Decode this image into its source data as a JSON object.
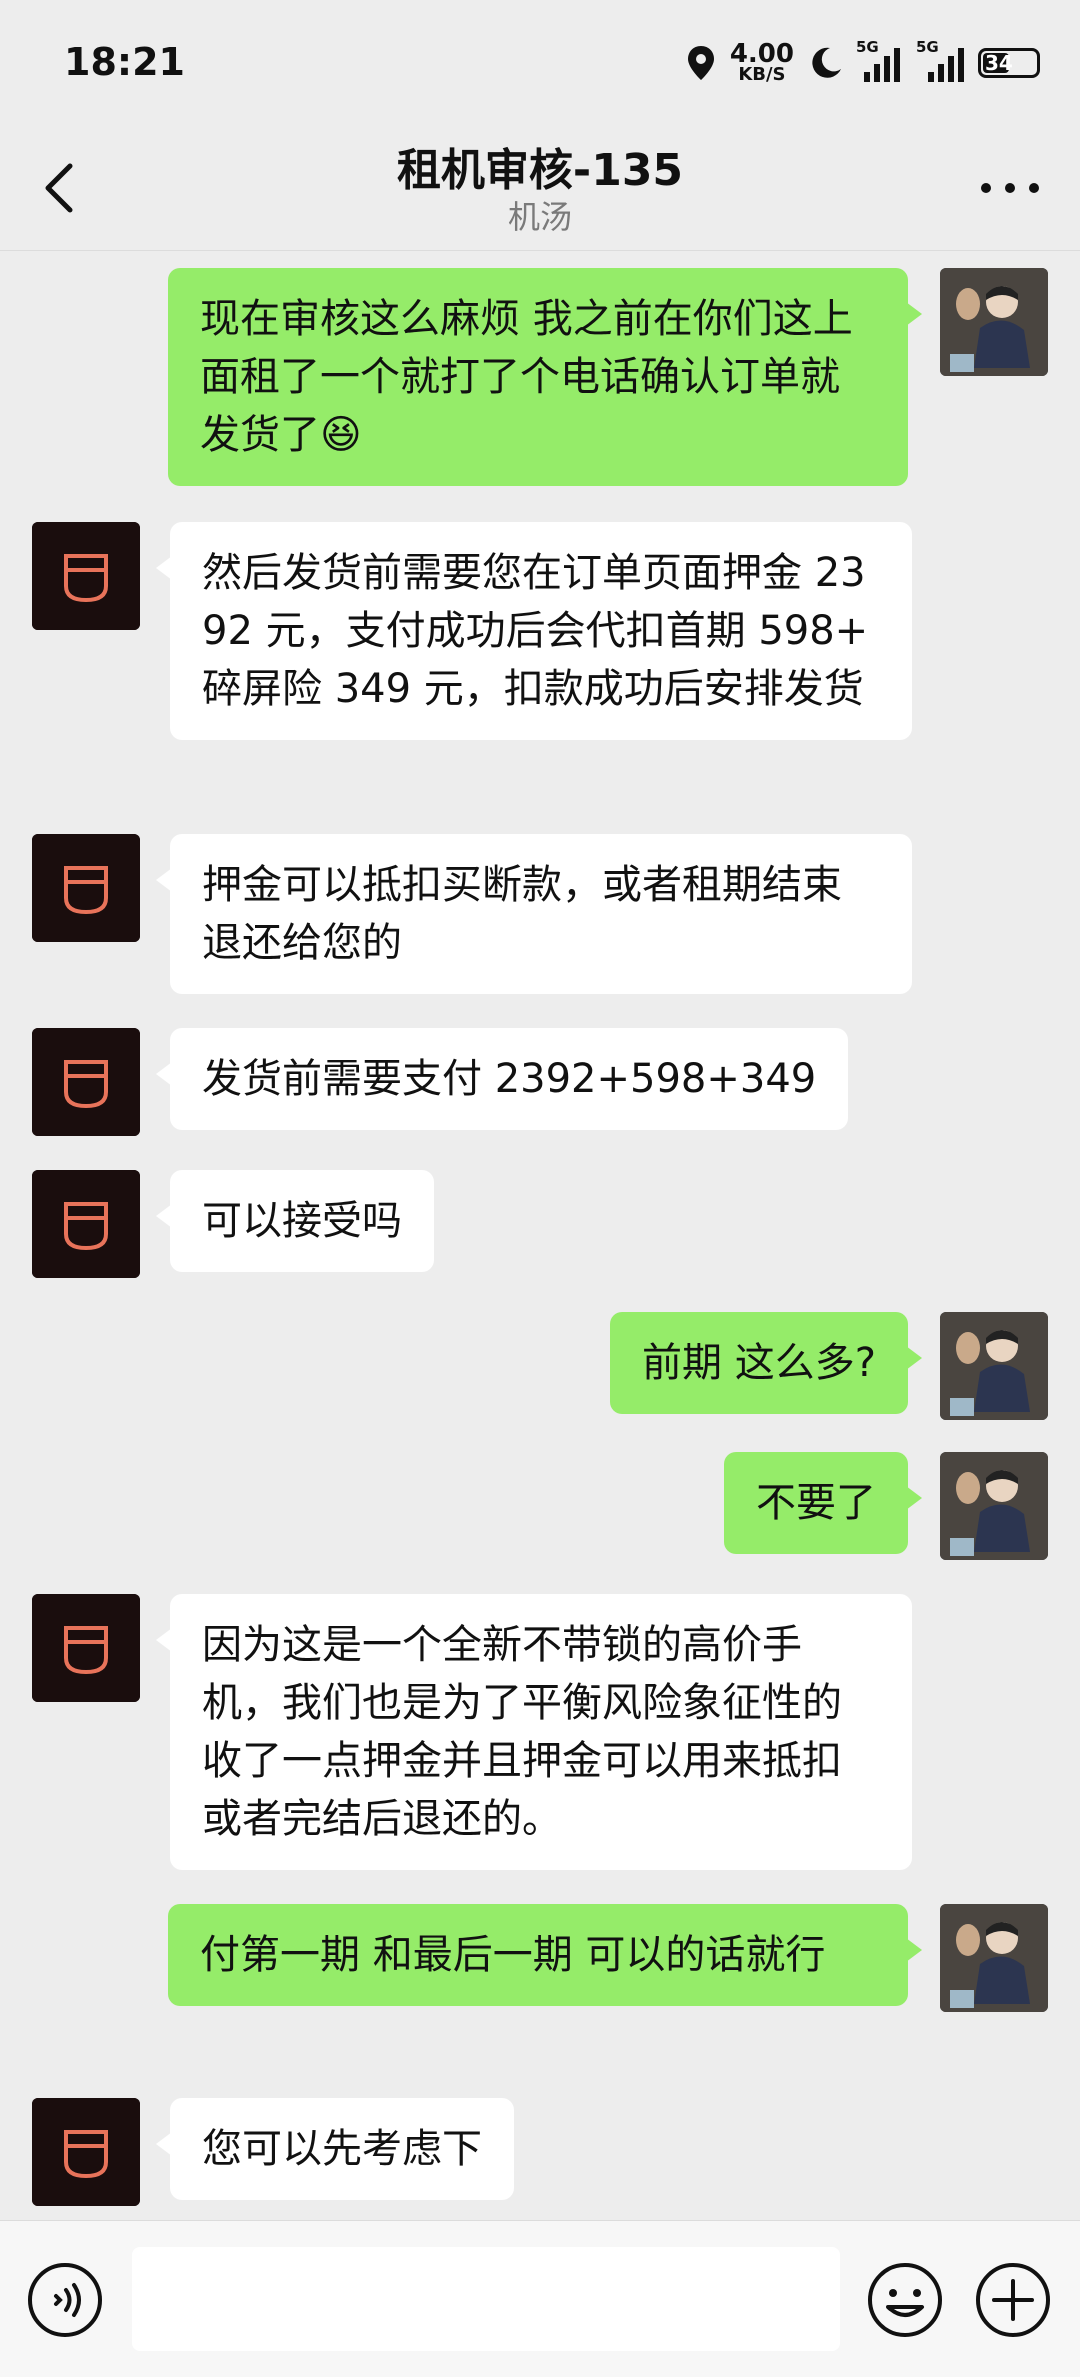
{
  "status_bar": {
    "time": "18:21",
    "net_speed_value": "4.00",
    "net_speed_unit": "KB/S",
    "signal1_label": "5G",
    "signal2_label": "5G",
    "battery": "34"
  },
  "header": {
    "title": "租机审核-135",
    "subtitle": "机汤"
  },
  "messages": [
    {
      "sender": "me",
      "text": "现在审核这么麻烦  我之前在你们这上面租了一个就打了个电话确认订单就发货了",
      "emoji": "😆"
    },
    {
      "sender": "them",
      "text": "然后发货前需要您在订单页面押金 2392  元，支付成功后会代扣首期  598+ 碎屏险 349 元，扣款成功后安排发货"
    },
    {
      "sender": "them",
      "text": "押金可以抵扣买断款，或者租期结束退还给您的"
    },
    {
      "sender": "them",
      "text": "发货前需要支付 2392+598+349"
    },
    {
      "sender": "them",
      "text": "可以接受吗"
    },
    {
      "sender": "me",
      "text": "前期 这么多?"
    },
    {
      "sender": "me",
      "text": "不要了"
    },
    {
      "sender": "them",
      "text": "因为这是一个全新不带锁的高价手机，我们也是为了平衡风险象征性的收了一点押金并且押金可以用来抵扣或者完结后退还的。"
    },
    {
      "sender": "me",
      "text": "付第一期 和最后一期 可以的话就行"
    },
    {
      "sender": "them",
      "text": "您可以先考虑下"
    }
  ],
  "input_bar": {
    "value": "",
    "placeholder": ""
  },
  "colors": {
    "background": "#ededed",
    "my_bubble": "#95ec69",
    "their_bubble": "#ffffff",
    "app_avatar_bg": "#1a0d0d",
    "app_avatar_logo": "#e8735a"
  }
}
